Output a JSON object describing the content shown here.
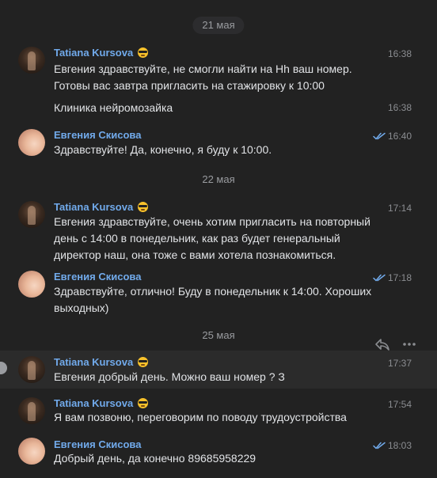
{
  "dates": [
    "21 мая",
    "22 мая",
    "25 мая"
  ],
  "colors": {
    "background": "#222222",
    "author": "#71aaeb",
    "text": "#e1e3e6",
    "muted": "#8b8d91",
    "read_check": "#71aaeb",
    "emoji": "#f7c12b"
  },
  "messages": [
    {
      "author": "Tatiana Kursova",
      "author_icon": "sunglasses-emoji-icon",
      "avatar": "tatiana",
      "time": "16:38",
      "text": "Евгения здравствуйте, не смогли найти на Hh ваш номер. Готовы вас завтра пригласить на стажировку к 10:00"
    },
    {
      "time": "16:38",
      "text": "Клиника нейромозайка"
    },
    {
      "author": "Евгения Скисова",
      "avatar": "evgenia",
      "time": "16:40",
      "read": true,
      "text": "Здравствуйте! Да, конечно,  я буду к 10:00."
    },
    {
      "author": "Tatiana Kursova",
      "author_icon": "sunglasses-emoji-icon",
      "avatar": "tatiana",
      "time": "17:14",
      "text": "Евгения здравствуйте, очень хотим пригласить на повторный день с 14:00 в понедельник, как раз будет генеральный директор наш, она тоже с вами хотела познакомиться."
    },
    {
      "author": "Евгения Скисова",
      "avatar": "evgenia",
      "time": "17:18",
      "read": true,
      "text": "Здравствуйте, отлично! Буду в понедельник к 14:00. Хороших выходных)"
    },
    {
      "author": "Tatiana Kursova",
      "author_icon": "sunglasses-emoji-icon",
      "avatar": "tatiana",
      "time": "17:37",
      "text": "Евгения добрый день. Можно ваш номер ? З"
    },
    {
      "author": "Tatiana Kursova",
      "author_icon": "sunglasses-emoji-icon",
      "avatar": "tatiana",
      "time": "17:54",
      "text": "Я вам позвоню, переговорим по поводу трудоустройства"
    },
    {
      "author": "Евгения Скисова",
      "avatar": "evgenia",
      "time": "18:03",
      "read": true,
      "text": "Добрый день, да конечно 89685958229"
    }
  ],
  "actions": [
    "reply-icon",
    "more-icon"
  ]
}
